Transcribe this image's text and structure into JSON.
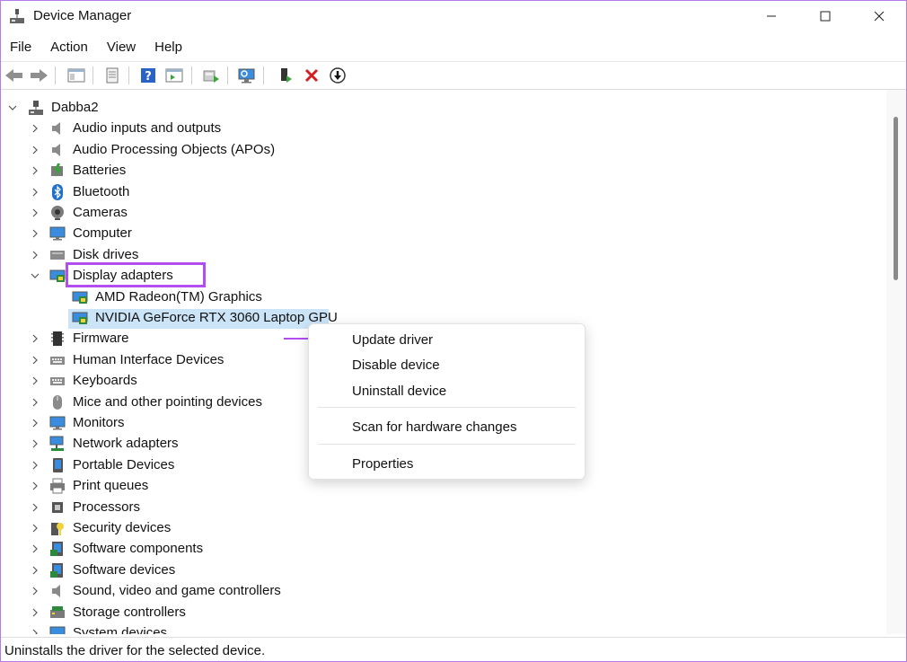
{
  "window": {
    "title": "Device Manager"
  },
  "menu": [
    "File",
    "Action",
    "View",
    "Help"
  ],
  "tree": {
    "root": "Dabba2",
    "categories": [
      {
        "label": "Audio inputs and outputs",
        "icon": "speaker-icon"
      },
      {
        "label": "Audio Processing Objects (APOs)",
        "icon": "speaker-icon"
      },
      {
        "label": "Batteries",
        "icon": "battery-icon"
      },
      {
        "label": "Bluetooth",
        "icon": "bluetooth-icon"
      },
      {
        "label": "Cameras",
        "icon": "camera-icon"
      },
      {
        "label": "Computer",
        "icon": "computer-icon"
      },
      {
        "label": "Disk drives",
        "icon": "disk-icon"
      },
      {
        "label": "Display adapters",
        "icon": "display-adapter-icon",
        "expanded": true,
        "children": [
          "AMD Radeon(TM) Graphics",
          "NVIDIA GeForce RTX 3060 Laptop GPU"
        ]
      },
      {
        "label": "Firmware",
        "icon": "chip-icon"
      },
      {
        "label": "Human Interface Devices",
        "icon": "keyboard-icon"
      },
      {
        "label": "Keyboards",
        "icon": "keyboard-icon"
      },
      {
        "label": "Mice and other pointing devices",
        "icon": "mouse-icon"
      },
      {
        "label": "Monitors",
        "icon": "monitor-icon"
      },
      {
        "label": "Network adapters",
        "icon": "network-icon"
      },
      {
        "label": "Portable Devices",
        "icon": "portable-device-icon"
      },
      {
        "label": "Print queues",
        "icon": "printer-icon"
      },
      {
        "label": "Processors",
        "icon": "processor-icon"
      },
      {
        "label": "Security devices",
        "icon": "security-icon"
      },
      {
        "label": "Software components",
        "icon": "software-icon"
      },
      {
        "label": "Software devices",
        "icon": "software-icon"
      },
      {
        "label": "Sound, video and game controllers",
        "icon": "speaker-icon"
      },
      {
        "label": "Storage controllers",
        "icon": "storage-icon"
      },
      {
        "label": "System devices",
        "icon": "system-icon"
      }
    ]
  },
  "context_menu": {
    "items": [
      "Update driver",
      "Disable device",
      "Uninstall device",
      "Scan for hardware changes",
      "Properties"
    ]
  },
  "status": {
    "text": "Uninstalls the driver for the selected device."
  },
  "colors": {
    "highlight": "#b24ef0",
    "selection": "#cce4f7"
  }
}
